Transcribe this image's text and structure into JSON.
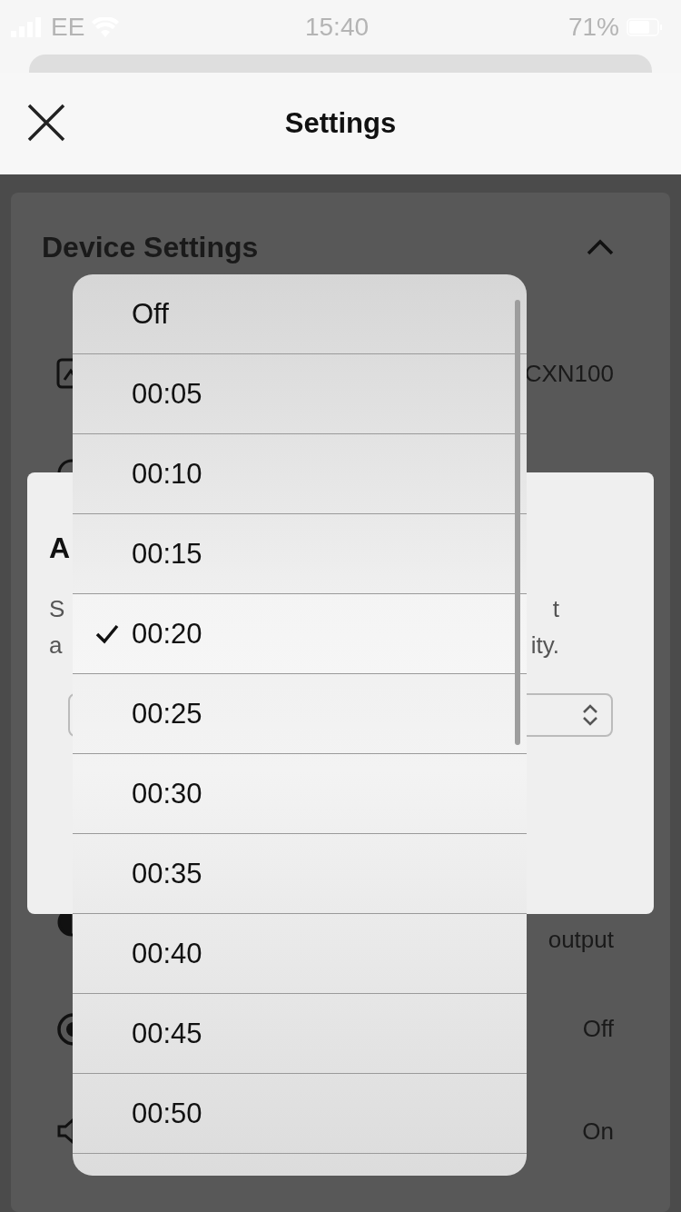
{
  "status_bar": {
    "carrier": "EE",
    "time": "15:40",
    "battery": "71%"
  },
  "header": {
    "title": "Settings"
  },
  "section": {
    "title": "Device Settings",
    "expanded": true,
    "rows": [
      {
        "kind": "device",
        "value": "CXN100"
      },
      {
        "kind": "power"
      },
      {
        "kind": "output",
        "value": "output"
      },
      {
        "kind": "record",
        "value": "Off"
      },
      {
        "kind": "speaker",
        "value": "On"
      }
    ]
  },
  "dialog": {
    "title": "A",
    "lines": [
      {
        "start": "S",
        "end": "t"
      },
      {
        "start": "a",
        "end": "ity."
      }
    ]
  },
  "dropdown": {
    "options": [
      {
        "label": "Off",
        "selected": false
      },
      {
        "label": "00:05",
        "selected": false
      },
      {
        "label": "00:10",
        "selected": false
      },
      {
        "label": "00:15",
        "selected": false
      },
      {
        "label": "00:20",
        "selected": true
      },
      {
        "label": "00:25",
        "selected": false
      },
      {
        "label": "00:30",
        "selected": false
      },
      {
        "label": "00:35",
        "selected": false
      },
      {
        "label": "00:40",
        "selected": false
      },
      {
        "label": "00:45",
        "selected": false
      },
      {
        "label": "00:50",
        "selected": false
      }
    ]
  }
}
